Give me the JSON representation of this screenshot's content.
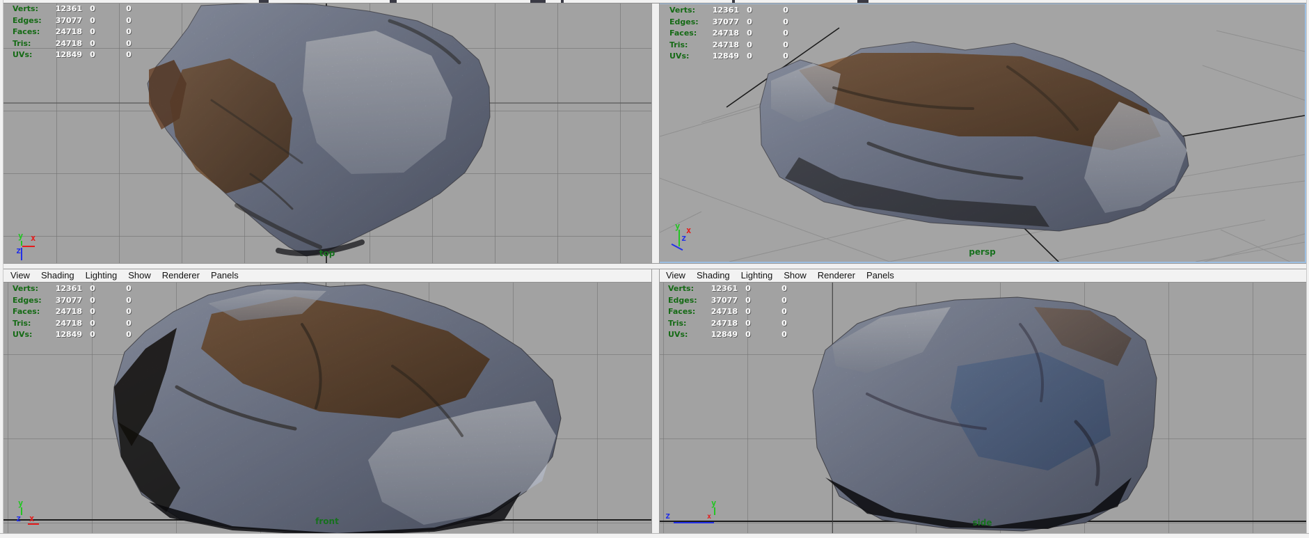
{
  "menu_bar": {
    "items": [
      "View",
      "Shading",
      "Lighting",
      "Show",
      "Renderer",
      "Panels"
    ]
  },
  "hud": {
    "rows": [
      {
        "label": "Verts:",
        "value": "12361",
        "c2": "0",
        "c3": "0"
      },
      {
        "label": "Edges:",
        "value": "37077",
        "c2": "0",
        "c3": "0"
      },
      {
        "label": "Faces:",
        "value": "24718",
        "c2": "0",
        "c3": "0"
      },
      {
        "label": "Tris:",
        "value": "24718",
        "c2": "0",
        "c3": "0"
      },
      {
        "label": "UVs:",
        "value": "12849",
        "c2": "0",
        "c3": "0"
      }
    ]
  },
  "viewports": {
    "top": {
      "label": "top",
      "selected": false
    },
    "persp": {
      "label": "persp",
      "selected": true
    },
    "front": {
      "label": "front",
      "selected": false
    },
    "side": {
      "label": "side",
      "selected": false
    }
  },
  "gizmo": {
    "x": "x",
    "y": "y",
    "z": "z"
  },
  "colors": {
    "viewport_bg": "#a2a2a2",
    "grid_line": "#8b8b8b",
    "hud_label": "#156a15",
    "hud_value": "#ffffff",
    "view_label": "#17701e",
    "menu_bg": "#f2f2f2",
    "menu_text": "#111111",
    "selected_border": "#9dbfe2",
    "axis_x": "#e41b1b",
    "axis_y": "#23c523",
    "axis_z": "#2330e8"
  }
}
